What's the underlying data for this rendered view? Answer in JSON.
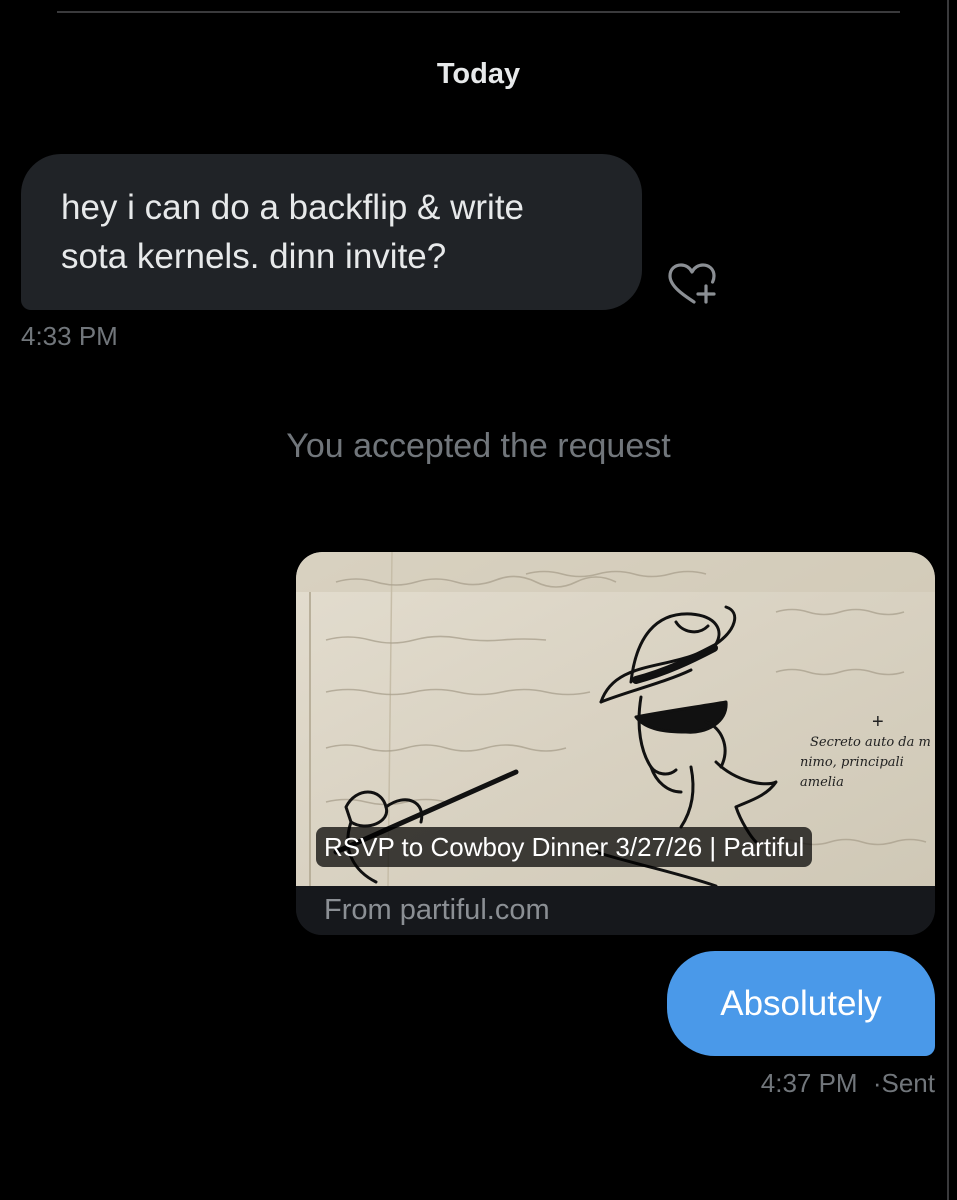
{
  "conversation": {
    "date_header": "Today",
    "messages": [
      {
        "direction": "received",
        "lines": [
          "hey i can do a backflip & write",
          "sota kernels. dinn invite?"
        ],
        "time": "4:33 PM"
      },
      {
        "direction": "sent",
        "text": "Absolutely",
        "time": "4:37 PM",
        "status": "Sent"
      }
    ],
    "system_notice": "You accepted the request",
    "link_preview": {
      "title": "RSVP to Cowboy Dinner 3/27/26 | Partiful",
      "domain": "From partiful.com",
      "image_text": [
        "Secreto auto da m",
        "nimo, principali",
        "amelia"
      ]
    }
  },
  "icons": {
    "react": "heart-plus-icon",
    "status_separator": "·"
  },
  "colors": {
    "background": "#000000",
    "received_bubble": "#202327",
    "sent_bubble": "#4a99e9",
    "secondary_text": "#71767b",
    "primary_text": "#e7e9ea"
  }
}
